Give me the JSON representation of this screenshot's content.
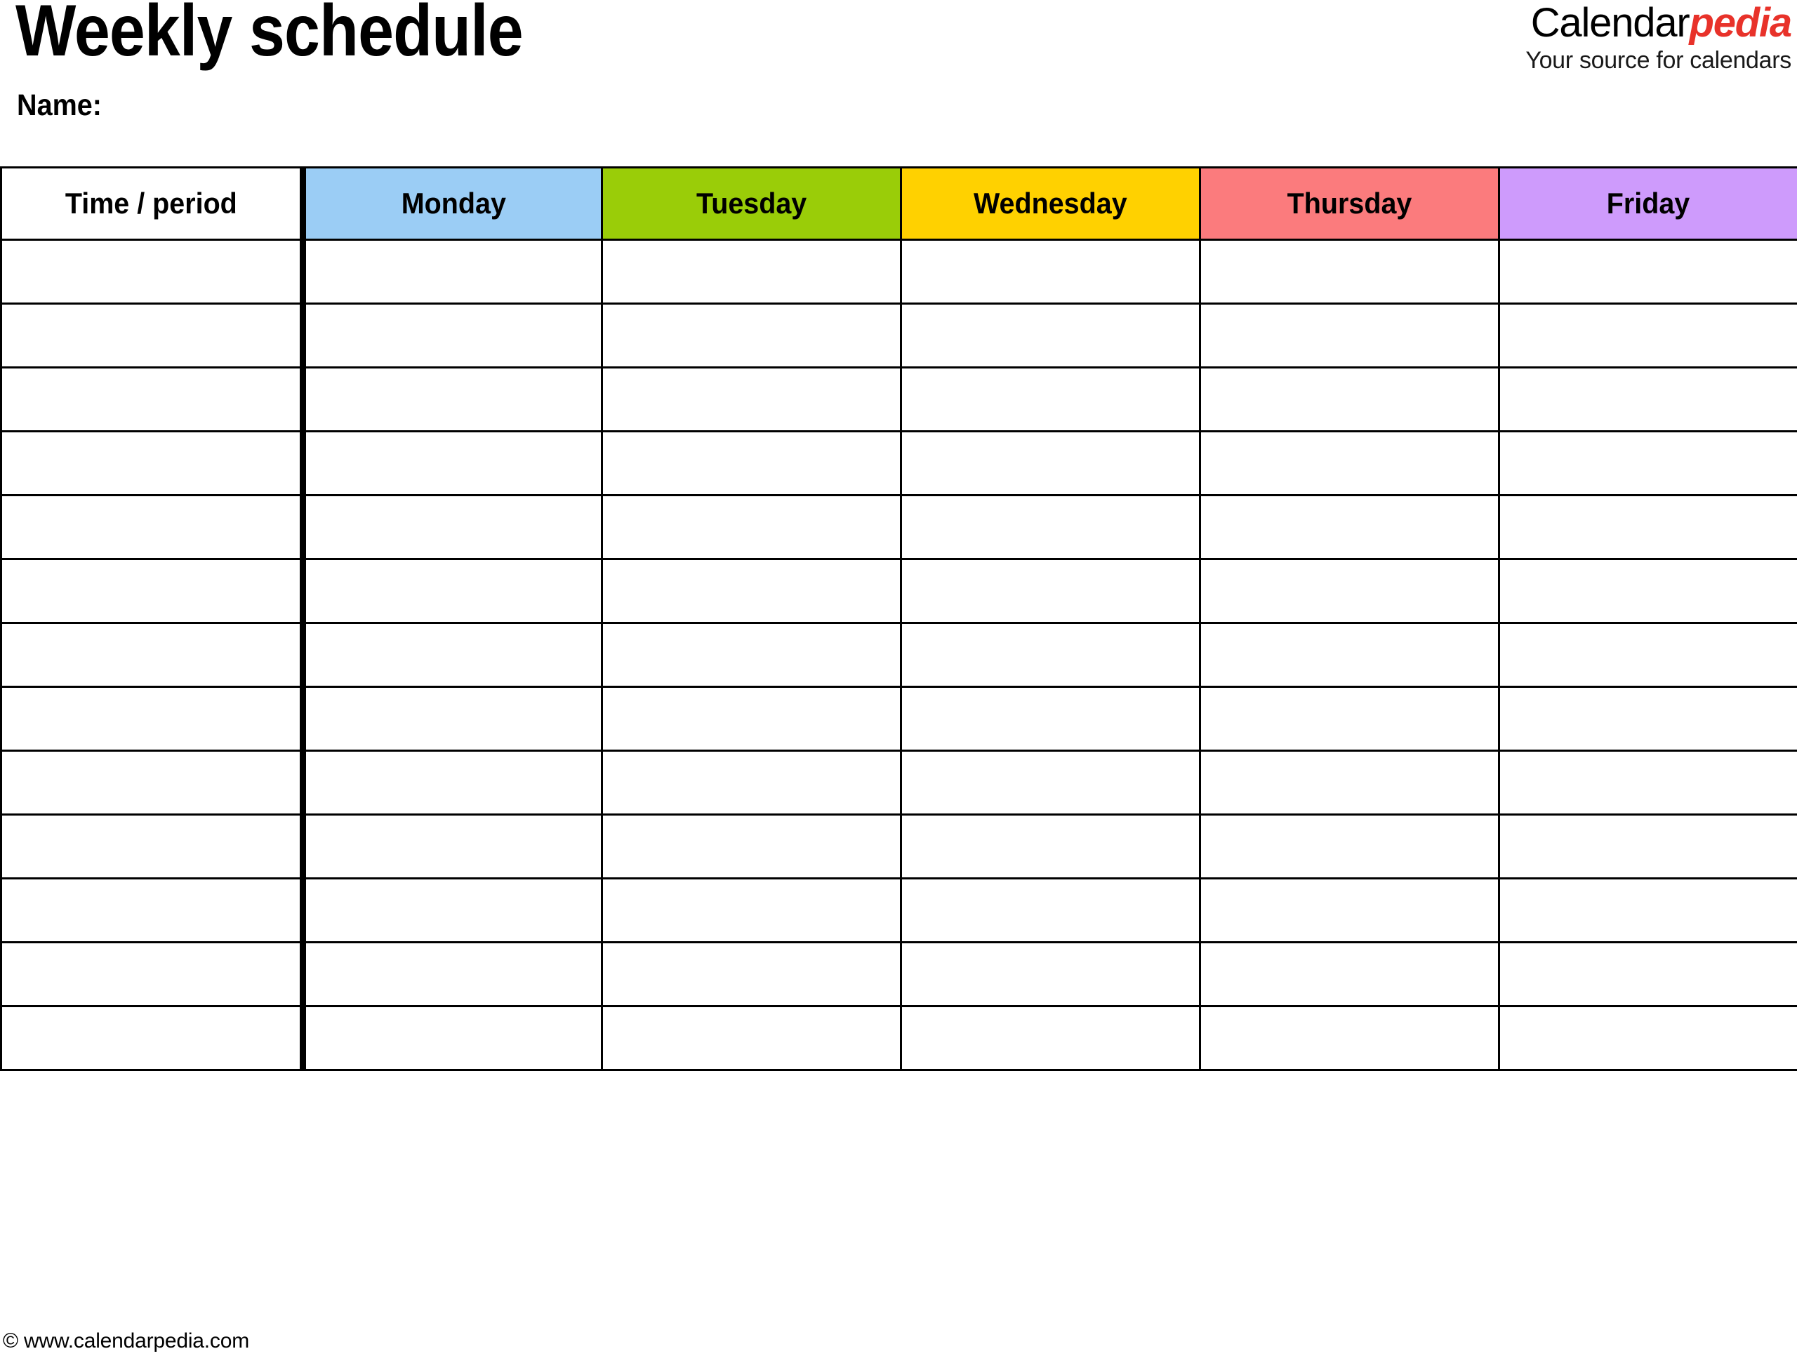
{
  "document": {
    "title": "Weekly schedule",
    "name_label": "Name:"
  },
  "brand": {
    "word_first": "Calendar",
    "word_second": "pedia",
    "tagline": "Your source for calendars",
    "accent_color": "#e8322a"
  },
  "table": {
    "columns": [
      {
        "label": "Time / period",
        "color": "#ffffff",
        "kind": "time"
      },
      {
        "label": "Monday",
        "color": "#9bcdf5",
        "kind": "day"
      },
      {
        "label": "Tuesday",
        "color": "#9acd08",
        "kind": "day"
      },
      {
        "label": "Wednesday",
        "color": "#ffd100",
        "kind": "day"
      },
      {
        "label": "Thursday",
        "color": "#fb7b7d",
        "kind": "day"
      },
      {
        "label": "Friday",
        "color": "#ce9bfc",
        "kind": "day"
      }
    ],
    "row_count": 13,
    "rows": [
      {
        "time": "",
        "cells": [
          "",
          "",
          "",
          "",
          ""
        ]
      },
      {
        "time": "",
        "cells": [
          "",
          "",
          "",
          "",
          ""
        ]
      },
      {
        "time": "",
        "cells": [
          "",
          "",
          "",
          "",
          ""
        ]
      },
      {
        "time": "",
        "cells": [
          "",
          "",
          "",
          "",
          ""
        ]
      },
      {
        "time": "",
        "cells": [
          "",
          "",
          "",
          "",
          ""
        ]
      },
      {
        "time": "",
        "cells": [
          "",
          "",
          "",
          "",
          ""
        ]
      },
      {
        "time": "",
        "cells": [
          "",
          "",
          "",
          "",
          ""
        ]
      },
      {
        "time": "",
        "cells": [
          "",
          "",
          "",
          "",
          ""
        ]
      },
      {
        "time": "",
        "cells": [
          "",
          "",
          "",
          "",
          ""
        ]
      },
      {
        "time": "",
        "cells": [
          "",
          "",
          "",
          "",
          ""
        ]
      },
      {
        "time": "",
        "cells": [
          "",
          "",
          "",
          "",
          ""
        ]
      },
      {
        "time": "",
        "cells": [
          "",
          "",
          "",
          "",
          ""
        ]
      },
      {
        "time": "",
        "cells": [
          "",
          "",
          "",
          "",
          ""
        ]
      }
    ]
  },
  "footer": {
    "copyright": "© www.calendarpedia.com"
  }
}
